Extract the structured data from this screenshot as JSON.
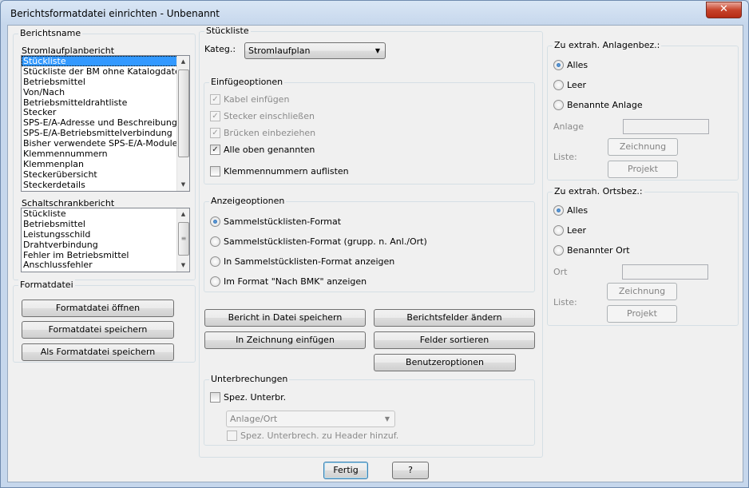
{
  "window": {
    "title": "Berichtsformatdatei einrichten - Unbenannt",
    "close_label": "✕"
  },
  "berichtsname": {
    "legend": "Berichtsname",
    "stromlauf_label": "Stromlaufplanbericht",
    "stromlauf_items": [
      "Stückliste",
      "Stückliste der BM ohne Katalogdaten",
      "Betriebsmittel",
      "Von/Nach",
      "Betriebsmitteldrahtliste",
      "Stecker",
      "SPS-E/A-Adresse und Beschreibungen",
      "SPS-E/A-Betriebsmittelverbindung",
      "Bisher verwendete SPS-E/A-Module",
      "Klemmennummern",
      "Klemmenplan",
      "Steckerübersicht",
      "Steckerdetails"
    ],
    "schaltschrank_label": "Schaltschrankbericht",
    "schaltschrank_items": [
      "Stückliste",
      "Betriebsmittel",
      "Leistungsschild",
      "Drahtverbindung",
      "Fehler im Betriebsmittel",
      "Anschlussfehler"
    ]
  },
  "formatdatei": {
    "legend": "Formatdatei",
    "open": "Formatdatei öffnen",
    "save": "Formatdatei speichern",
    "save_as": "Als Formatdatei speichern"
  },
  "stueckliste": {
    "legend": "Stückliste",
    "kateg_label": "Kateg.:",
    "kateg_value": "Stromlaufplan",
    "einfuege": {
      "legend": "Einfügeoptionen",
      "kabel": "Kabel einfügen",
      "stecker": "Stecker einschließen",
      "bruecken": "Brücken einbeziehen",
      "alle": "Alle oben genannten",
      "klemmen": "Klemmennummern auflisten"
    },
    "anzeige": {
      "legend": "Anzeigeoptionen",
      "opt1": "Sammelstücklisten-Format",
      "opt2": "Sammelstücklisten-Format (grupp. n. Anl./Ort)",
      "opt3": "In Sammelstücklisten-Format anzeigen",
      "opt4": "Im Format \"Nach BMK\" anzeigen"
    },
    "buttons": {
      "bericht_speichern": "Bericht in Datei speichern",
      "berichtsfelder": "Berichtsfelder ändern",
      "in_zeichnung": "In Zeichnung einfügen",
      "felder_sortieren": "Felder sortieren",
      "benutzeroptionen": "Benutzeroptionen"
    },
    "unterbrechungen": {
      "legend": "Unterbrechungen",
      "spez": "Spez. Unterbr.",
      "combo_value": "Anlage/Ort",
      "header": "Spez. Unterbrech. zu Header hinzuf."
    }
  },
  "anlagen": {
    "legend": "Zu extrah. Anlagenbez.:",
    "alles": "Alles",
    "leer": "Leer",
    "benannte": "Benannte Anlage",
    "field_label": "Anlage",
    "liste_label": "Liste:",
    "zeichnung": "Zeichnung",
    "projekt": "Projekt"
  },
  "orts": {
    "legend": "Zu extrah. Ortsbez.:",
    "alles": "Alles",
    "leer": "Leer",
    "benannter": "Benannter Ort",
    "field_label": "Ort",
    "liste_label": "Liste:",
    "zeichnung": "Zeichnung",
    "projekt": "Projekt"
  },
  "footer": {
    "fertig": "Fertig",
    "help": "?"
  }
}
